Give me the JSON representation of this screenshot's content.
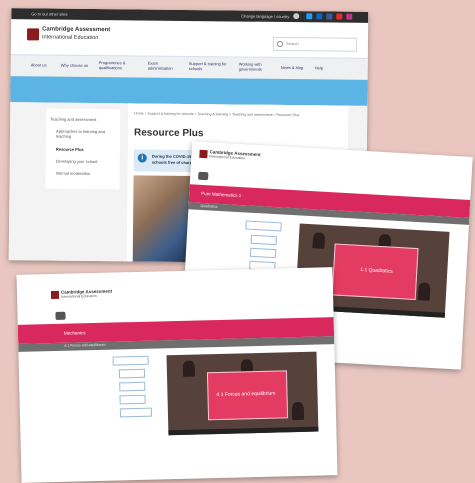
{
  "page1": {
    "topbar": {
      "left_text": "Go to our other sites",
      "right_text": "Change language / country"
    },
    "logo": {
      "line1": "Cambridge Assessment",
      "line2": "International Education"
    },
    "search": {
      "placeholder": "Search"
    },
    "nav": [
      "About us",
      "Why choose us",
      "Programmes & qualifications",
      "Exam administration",
      "Support & training for schools",
      "Working with governments",
      "News & blog",
      "Help"
    ],
    "sidebar": [
      "Teaching and assessment",
      "Approaches to learning and teaching",
      "Resource Plus",
      "Developing your school",
      "Internal moderation"
    ],
    "breadcrumb": "Home  >  Support & training for schools  >  Teaching & learning  >  Teaching and assessment  >  Resource Plus",
    "title": "Resource Plus",
    "notice": [
      "During the COVID-19 outbreak we will be offering Resource Plus to all",
      "schools free of charge"
    ]
  },
  "page2": {
    "logo": {
      "line1": "Cambridge Assessment",
      "line2": "International Education"
    },
    "banner": "Pure Mathematics 1",
    "subbar": "Quadratics",
    "slide_title": "1.1 Quadratics"
  },
  "page3": {
    "logo": {
      "line1": "Cambridge Assessment",
      "line2": "International Education"
    },
    "banner": "Mechanics",
    "subbar": "4.1 Forces and equilibrium",
    "slide_title": "4.1 Forces and equilibrium"
  },
  "colors": {
    "background": "#e9c7c0",
    "brand_red": "#8a1c1c",
    "banner_pink": "#d9285e",
    "hero_blue": "#5bb4e3",
    "notice_blue": "#dbeaf6"
  },
  "icons": [
    "twitter-icon",
    "linkedin-icon",
    "facebook-icon",
    "youtube-icon",
    "instagram-icon",
    "search-icon",
    "info-icon",
    "back-icon"
  ]
}
